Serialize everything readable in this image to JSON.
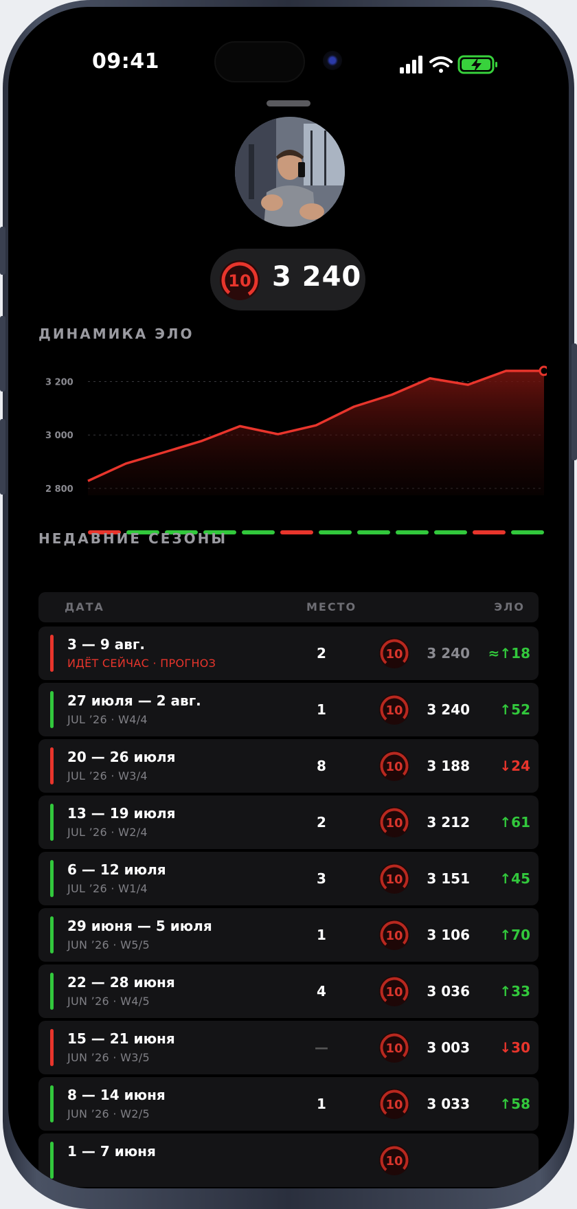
{
  "status_bar": {
    "time": "09:41"
  },
  "profile": {
    "elo": "3 240",
    "level": "10"
  },
  "chart_section": {
    "title": "ДИНАМИКА ЭЛО"
  },
  "chart_data": {
    "type": "area",
    "title": "ДИНАМИКА ЭЛО",
    "xlabel": "",
    "ylabel": "",
    "x": [
      1,
      2,
      3,
      4,
      5,
      6,
      7,
      8,
      9,
      10,
      11,
      12,
      13
    ],
    "series": [
      {
        "values": [
          2828,
          2893,
          2935,
          2978,
          3033,
          3003,
          3036,
          3106,
          3151,
          3212,
          3188,
          3240,
          3240
        ]
      }
    ],
    "yticks": [
      2800,
      3000,
      3200
    ],
    "ytick_labels": [
      "2 800",
      "3 000",
      "3 200"
    ],
    "ylim": [
      2800,
      3250
    ],
    "results": [
      "loss",
      "win",
      "win",
      "win",
      "win",
      "loss",
      "win",
      "win",
      "win",
      "win",
      "loss",
      "win"
    ],
    "grid": true,
    "colors": {
      "line": "#e8352c",
      "win": "#32c83c",
      "loss": "#e8352c"
    }
  },
  "seasons": {
    "title": "НЕДАВНИЕ СЕЗОНЫ",
    "headers": {
      "date": "ДАТА",
      "place": "МЕСТО",
      "elo": "ЭЛО"
    },
    "rows": [
      {
        "dates": "3 — 9 авг.",
        "sub": "ИДЁТ СЕЙЧАС · ПРОГНОЗ",
        "place": "2",
        "level": "10",
        "elo": "3 240",
        "delta": "≈↑18",
        "result": "loss",
        "current": true
      },
      {
        "dates": "27 июля — 2 авг.",
        "sub": "JUL ’26 · W4/4",
        "place": "1",
        "level": "10",
        "elo": "3 240",
        "delta": "↑52",
        "result": "win"
      },
      {
        "dates": "20 — 26 июля",
        "sub": "JUL ’26 · W3/4",
        "place": "8",
        "level": "10",
        "elo": "3 188",
        "delta": "↓24",
        "result": "loss"
      },
      {
        "dates": "13 — 19 июля",
        "sub": "JUL ’26 · W2/4",
        "place": "2",
        "level": "10",
        "elo": "3 212",
        "delta": "↑61",
        "result": "win"
      },
      {
        "dates": "6 — 12 июля",
        "sub": "JUL ’26 · W1/4",
        "place": "3",
        "level": "10",
        "elo": "3 151",
        "delta": "↑45",
        "result": "win"
      },
      {
        "dates": "29 июня — 5 июля",
        "sub": "JUN ’26 · W5/5",
        "place": "1",
        "level": "10",
        "elo": "3 106",
        "delta": "↑70",
        "result": "win"
      },
      {
        "dates": "22 — 28 июня",
        "sub": "JUN ’26 · W4/5",
        "place": "4",
        "level": "10",
        "elo": "3 036",
        "delta": "↑33",
        "result": "win"
      },
      {
        "dates": "15 — 21 июня",
        "sub": "JUN ’26 · W3/5",
        "place": "—",
        "level": "10",
        "elo": "3 003",
        "delta": "↓30",
        "result": "loss"
      },
      {
        "dates": "8 — 14 июня",
        "sub": "JUN ’26 · W2/5",
        "place": "1",
        "level": "10",
        "elo": "3 033",
        "delta": "↑58",
        "result": "win"
      },
      {
        "dates": "1 — 7 июня",
        "sub": "",
        "place": "",
        "level": "10",
        "elo": "",
        "delta": "",
        "result": "win"
      }
    ]
  },
  "colors": {
    "background": "#000000",
    "card": "#141416",
    "win": "#32c83c",
    "loss": "#e8352c",
    "muted": "#808086"
  }
}
